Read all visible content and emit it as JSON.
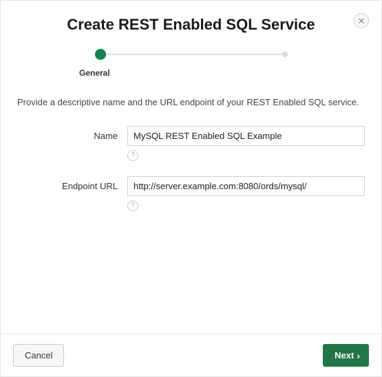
{
  "dialog": {
    "title": "Create REST Enabled SQL Service",
    "close_icon": "✕"
  },
  "wizard": {
    "step_label": "General"
  },
  "form": {
    "description": "Provide a descriptive name and the URL endpoint of your REST Enabled SQL service.",
    "name": {
      "label": "Name",
      "value": "MySQL REST Enabled SQL Example",
      "help_icon": "?"
    },
    "endpoint": {
      "label": "Endpoint URL",
      "value": "http://server.example.com:8080/ords/mysql/",
      "help_icon": "?"
    }
  },
  "footer": {
    "cancel_label": "Cancel",
    "next_label": "Next",
    "next_chevron": "›"
  }
}
